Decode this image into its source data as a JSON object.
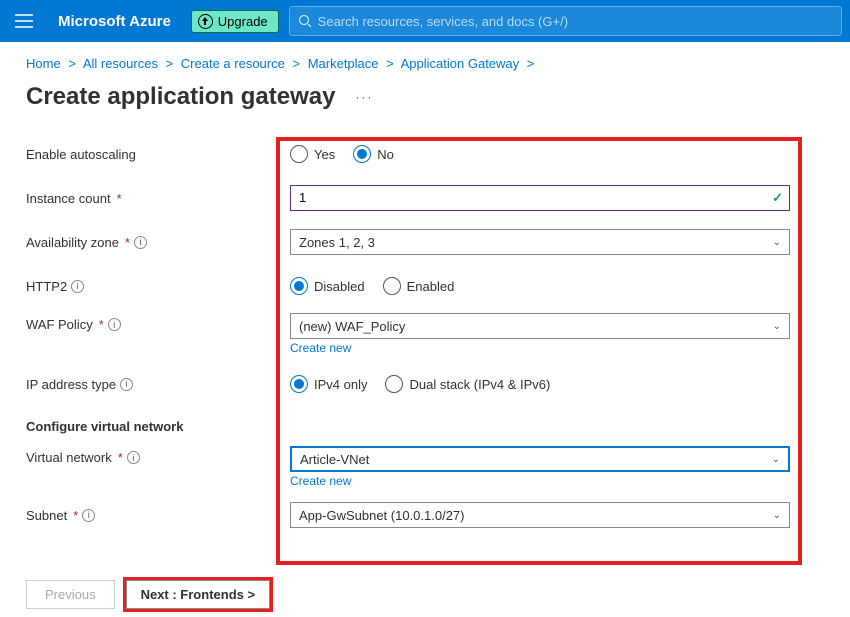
{
  "header": {
    "brand": "Microsoft Azure",
    "upgrade_label": "Upgrade",
    "search_placeholder": "Search resources, services, and docs (G+/)"
  },
  "breadcrumb": [
    {
      "label": "Home"
    },
    {
      "label": "All resources"
    },
    {
      "label": "Create a resource"
    },
    {
      "label": "Marketplace"
    },
    {
      "label": "Application Gateway"
    }
  ],
  "page": {
    "title": "Create application gateway"
  },
  "form": {
    "autoscaling": {
      "label": "Enable autoscaling",
      "option_yes": "Yes",
      "option_no": "No",
      "selected": "no"
    },
    "instance_count": {
      "label": "Instance count",
      "value": "1"
    },
    "availability_zone": {
      "label": "Availability zone",
      "value": "Zones 1, 2, 3"
    },
    "http2": {
      "label": "HTTP2",
      "option_disabled": "Disabled",
      "option_enabled": "Enabled",
      "selected": "disabled"
    },
    "waf_policy": {
      "label": "WAF Policy",
      "value": "(new) WAF_Policy",
      "create_new_label": "Create new"
    },
    "ip_type": {
      "label": "IP address type",
      "option_ipv4": "IPv4 only",
      "option_dual": "Dual stack (IPv4 & IPv6)",
      "selected": "ipv4"
    },
    "vnet_section": "Configure virtual network",
    "virtual_network": {
      "label": "Virtual network",
      "value": "Article-VNet",
      "create_new_label": "Create new"
    },
    "subnet": {
      "label": "Subnet",
      "value": "App-GwSubnet (10.0.1.0/27)"
    }
  },
  "wizard": {
    "previous": "Previous",
    "next": "Next : Frontends >"
  }
}
